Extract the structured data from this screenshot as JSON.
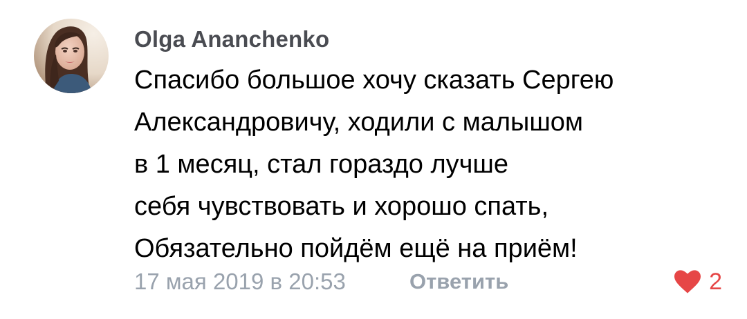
{
  "comment": {
    "author": "Olga Ananchenko",
    "text_lines": [
      "Спасибо большое хочу сказать Сергею",
      "Александровичу, ходили с малышом",
      "в 1 месяц, стал гораздо лучше",
      "себя чувствовать и хорошо спать,",
      "Обязательно пойдём ещё на приём!"
    ],
    "date": "17 мая 2019 в 20:53",
    "reply_label": "Ответить",
    "likes": "2",
    "liked": true,
    "colors": {
      "author": "#4a4c52",
      "meta": "#99a2ad",
      "like": "#e64646"
    },
    "icons": {
      "avatar": "user-avatar-photo",
      "like": "heart-icon"
    }
  }
}
